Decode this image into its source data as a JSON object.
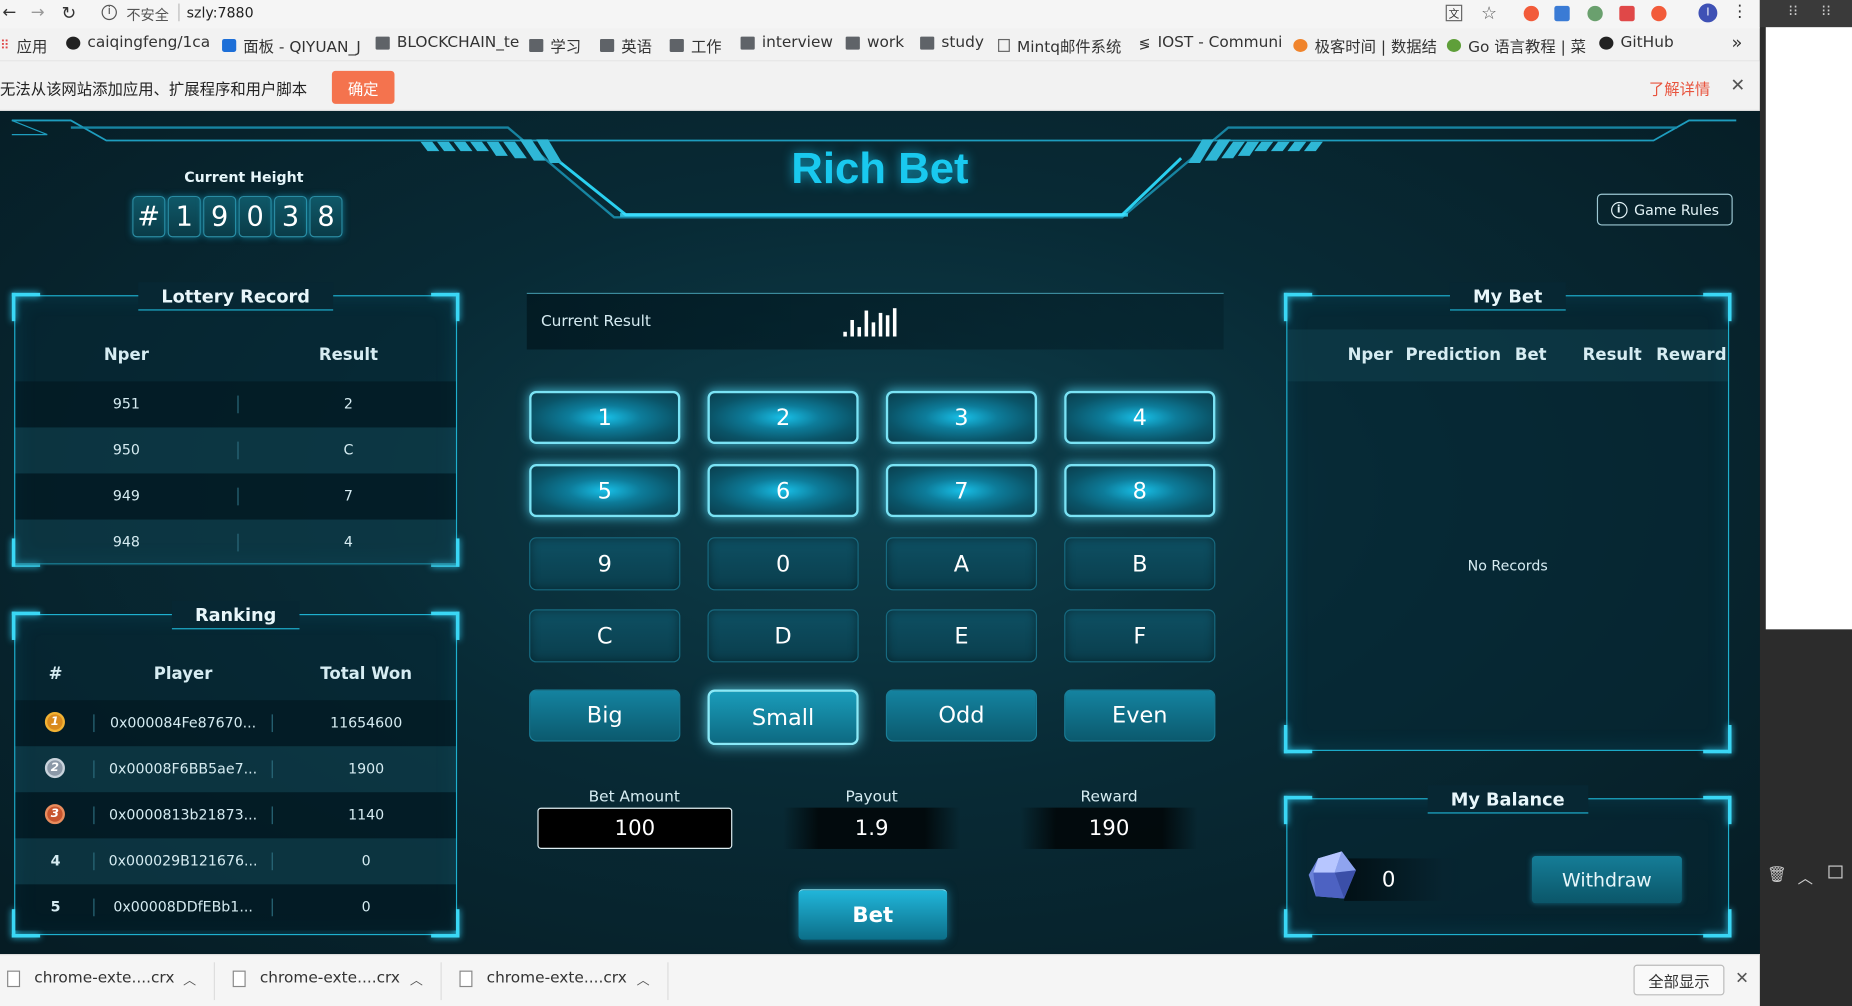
{
  "browser": {
    "security_label": "不安全",
    "url": "szly:7880",
    "bookmarks": [
      "应用",
      "caiqingfeng/1ca",
      "面板 - QIYUAN_J",
      "BLOCKCHAIN_te",
      "学习",
      "英语",
      "工作",
      "interview",
      "work",
      "study",
      "Mintq邮件系统",
      "IOST - Communi",
      "极客时间 | 数据结",
      "Go 语言教程 | 菜",
      "GitHub"
    ],
    "more_bookmarks": "»",
    "infobar_message": "无法从该网站添加应用、扩展程序和用户脚本",
    "infobar_ok": "确定",
    "infobar_learn": "了解详情",
    "close_glyph": "✕"
  },
  "app": {
    "title": "Rich Bet",
    "height_label": "Current Height",
    "height_digits": [
      "#",
      "1",
      "9",
      "0",
      "3",
      "8"
    ],
    "game_rules": "Game Rules",
    "lottery": {
      "title": "Lottery Record",
      "headers": [
        "Nper",
        "Result"
      ],
      "rows": [
        {
          "nper": "951",
          "result": "2"
        },
        {
          "nper": "950",
          "result": "C"
        },
        {
          "nper": "949",
          "result": "7"
        },
        {
          "nper": "948",
          "result": "4"
        }
      ]
    },
    "ranking": {
      "title": "Ranking",
      "headers": [
        "#",
        "Player",
        "Total Won"
      ],
      "rows": [
        {
          "rank": "1",
          "player": "0x000084Fe87670...",
          "won": "11654600"
        },
        {
          "rank": "2",
          "player": "0x00008F6BB5ae7...",
          "won": "1900"
        },
        {
          "rank": "3",
          "player": "0x0000813b21873...",
          "won": "1140"
        },
        {
          "rank": "4",
          "player": "0x000029B121676...",
          "won": "0"
        },
        {
          "rank": "5",
          "player": "0x00008DDfEBb1...",
          "won": "0"
        }
      ]
    },
    "current_result_label": "Current Result",
    "number_buttons": [
      "1",
      "2",
      "3",
      "4",
      "5",
      "6",
      "7",
      "8",
      "9",
      "0",
      "A",
      "B",
      "C",
      "D",
      "E",
      "F"
    ],
    "option_buttons": [
      "Big",
      "Small",
      "Odd",
      "Even"
    ],
    "selected_option": "Small",
    "bet_amount_label": "Bet Amount",
    "bet_amount": "100",
    "payout_label": "Payout",
    "payout": "1.9",
    "reward_label": "Reward",
    "reward": "190",
    "bet_button": "Bet",
    "my_bet": {
      "title": "My Bet",
      "headers": [
        "Nper",
        "Prediction",
        "Bet",
        "Result",
        "Reward"
      ],
      "empty": "No Records"
    },
    "balance": {
      "title": "My Balance",
      "value": "0",
      "withdraw": "Withdraw"
    }
  },
  "downloads": {
    "files": [
      "chrome-exte....crx",
      "chrome-exte....crx",
      "chrome-exte....crx"
    ],
    "show_all": "全部显示"
  }
}
